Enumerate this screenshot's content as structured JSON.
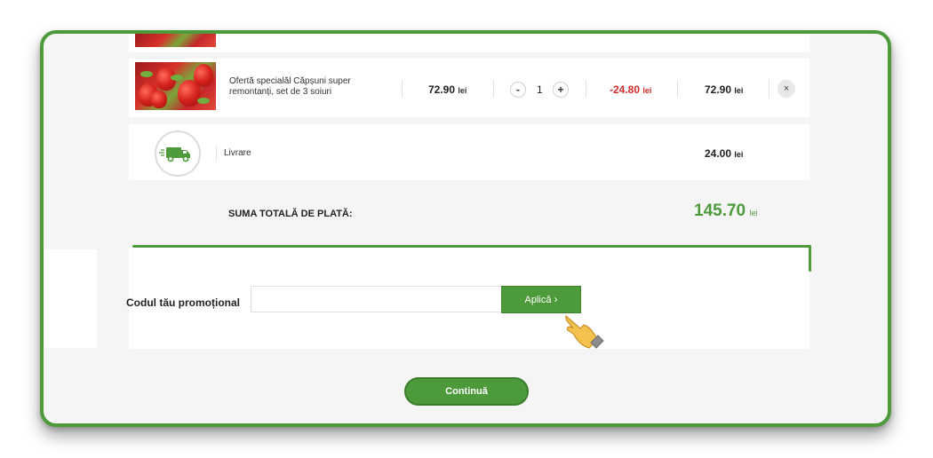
{
  "cart": {
    "product": {
      "name": "Ofertă specială! Căpșuni super remontanți, set de 3 soiuri",
      "name_line1": "Ofertă specialăl Căpșuni super",
      "name_line2": "remontanți, set de 3 soiuri",
      "price": "72.90",
      "quantity": "1",
      "discount": "-24.80",
      "total": "72.90",
      "currency": "lei",
      "minus": "-",
      "plus": "+",
      "remove": "×"
    },
    "delivery": {
      "label": "Livrare",
      "price": "24.00",
      "currency": "lei"
    },
    "total": {
      "label": "SUMA TOTALĂ DE PLATĂ:",
      "amount": "145.70",
      "currency": "lei"
    }
  },
  "promo": {
    "label": "Codul tău promoțional",
    "input_value": "",
    "input_placeholder": "",
    "apply_label": "Aplică"
  },
  "actions": {
    "continue_label": "Continuă"
  },
  "colors": {
    "accent": "#4c9a3a",
    "discount": "#d62b2b",
    "background": "#f5f5f5"
  }
}
